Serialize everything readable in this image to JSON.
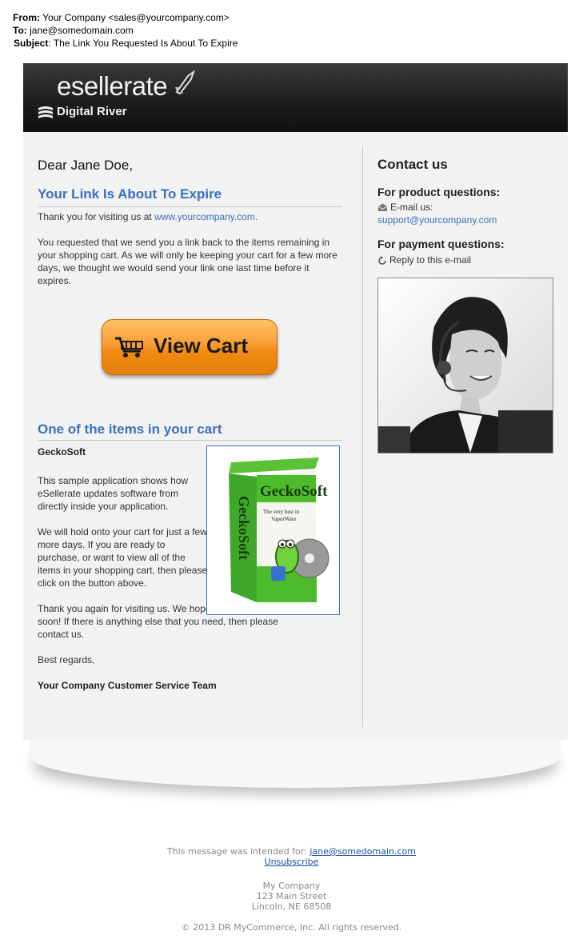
{
  "email": {
    "from_label": "From:",
    "from_value": "Your Company <sales@yourcompany.com>",
    "to_label": "To:",
    "to_value": "jane@somedomain.com",
    "subject_label": "Subject",
    "subject_value": ": The Link You Requested Is About To Expire"
  },
  "banner": {
    "logo_text": "esellerate",
    "sub_logo_text": "Digital River"
  },
  "body": {
    "greeting": "Dear Jane Doe,",
    "title": "Your Link Is About To Expire",
    "thanks_prefix": "Thank you for visiting us at ",
    "thanks_link": "www.yourcompany.com.",
    "request_text": "You requested that we send you a link back to the items remaining in your shopping cart. As we will only be keeping your cart for a few more days, we thought we would send your link one last time before it expires.",
    "cart_button": "View Cart",
    "items_title": "One of the items in your cart",
    "product_name": "GeckoSoft",
    "product_desc": "This sample application shows how eSellerate updates software from directly inside your application.",
    "hold_text": "We will hold onto your cart for just a few more days. If you are ready to purchase, or want to view all of the items in your shopping cart, then please click on the button above.",
    "again_text": "Thank you again for visiting us. We hope to see you again soon! If there is anything else that you need, then please contact us.",
    "regards": "Best regards,",
    "team": "Your Company Customer Service Team",
    "box_title": "GeckoSoft",
    "box_tagline": "The very best in VaporWare"
  },
  "contact": {
    "title": "Contact us",
    "product_heading": "For product questions:",
    "email_label": "E-mail us:",
    "email_link": "support@yourcompany.com",
    "payment_heading": "For payment questions:",
    "reply_text": "Reply to this e-mail"
  },
  "footer": {
    "intended_prefix": "This message was intended for: ",
    "intended_email": "jane@somedomain.com",
    "unsubscribe": "Unsubscribe",
    "company": "My Company",
    "address": "123 Main Street",
    "city": "Lincoln, NE 68508",
    "copyright": "© 2013 DR MyCommerce, Inc. All rights reserved."
  },
  "colors": {
    "accent_blue": "#3b6fc0",
    "button_orange": "#f08a10",
    "panel_bg": "#f2f2f2"
  }
}
